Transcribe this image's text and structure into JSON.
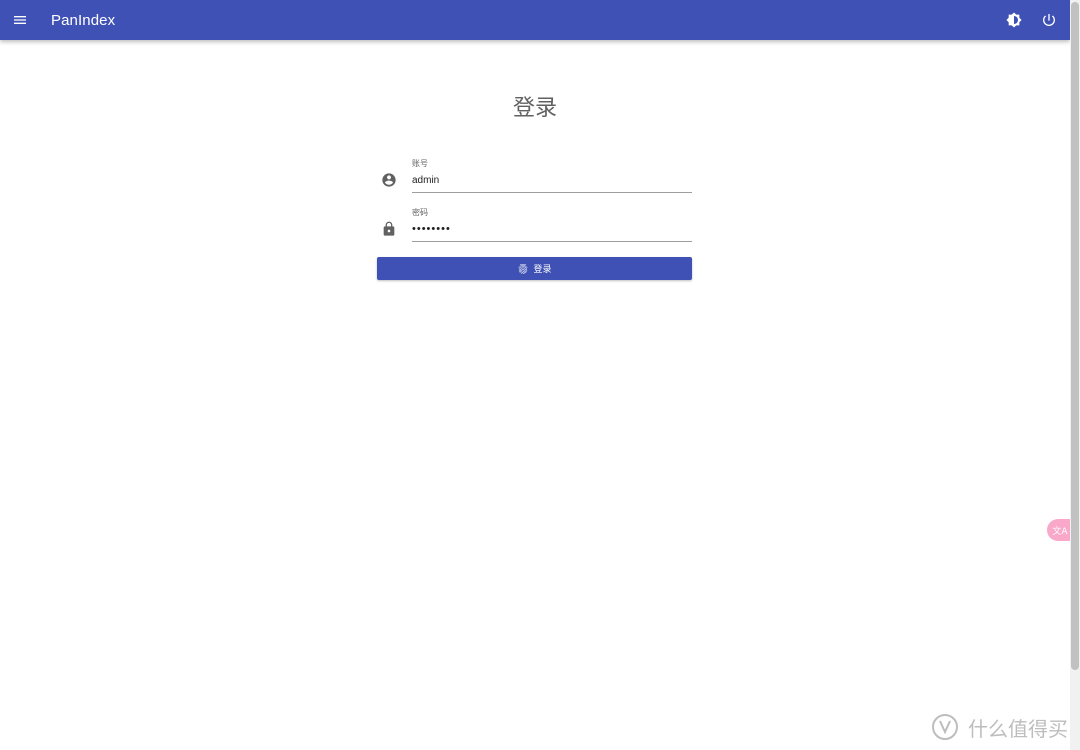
{
  "appbar": {
    "title": "PanIndex",
    "menu_icon": "menu-icon",
    "theme_icon": "brightness-icon",
    "power_icon": "power-icon",
    "color": "#3f51b5"
  },
  "login": {
    "title": "登录",
    "username": {
      "label": "账号",
      "value": "admin",
      "icon": "account-circle-icon"
    },
    "password": {
      "label": "密码",
      "value": "password",
      "icon": "lock-icon"
    },
    "submit": {
      "label": "登录",
      "icon": "fingerprint-icon"
    }
  },
  "floating": {
    "translate_icon": "translate-icon",
    "translate_glyph": "文A"
  },
  "watermark": {
    "text": "什么值得买"
  }
}
